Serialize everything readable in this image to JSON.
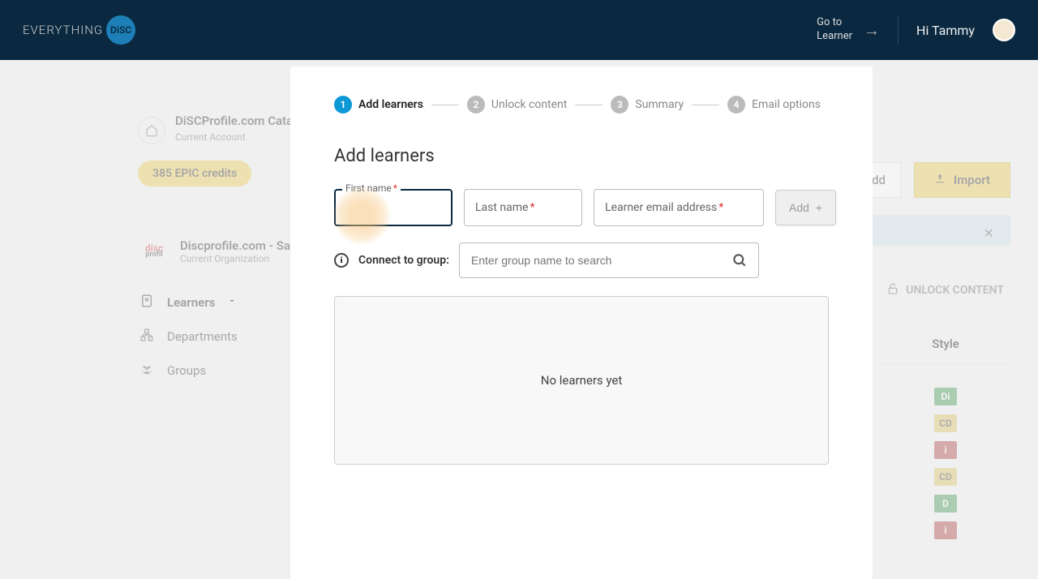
{
  "header": {
    "logo_text": "EVERYTHING",
    "logo_badge": "DiSC",
    "goto_line1": "Go to",
    "goto_line2": "Learner",
    "greeting": "Hi Tammy"
  },
  "sidebar": {
    "account_name": "DiSCProfile.com Catalyst",
    "account_sub": "Current Account",
    "credits": "385 EPIC credits",
    "org_name": "Discprofile.com - Samp",
    "org_sub": "Current Organization",
    "nav": {
      "learners": "Learners",
      "departments": "Departments",
      "groups": "Groups"
    }
  },
  "main": {
    "import_btn": "Import",
    "add_btn_partial": "dd",
    "unlock": "UNLOCK CONTENT",
    "style_col": "Style",
    "badges": [
      "Di",
      "CD",
      "i",
      "CD",
      "D",
      "i"
    ]
  },
  "modal": {
    "steps": {
      "s1": "Add learners",
      "s2": "Unlock content",
      "s3": "Summary",
      "s4": "Email options"
    },
    "title": "Add learners",
    "first_name_label": "First name",
    "last_name_label": "Last name",
    "email_label": "Learner email address",
    "add_btn": "Add",
    "connect_label": "Connect to group:",
    "group_placeholder": "Enter group name to search",
    "empty": "No learners yet"
  }
}
